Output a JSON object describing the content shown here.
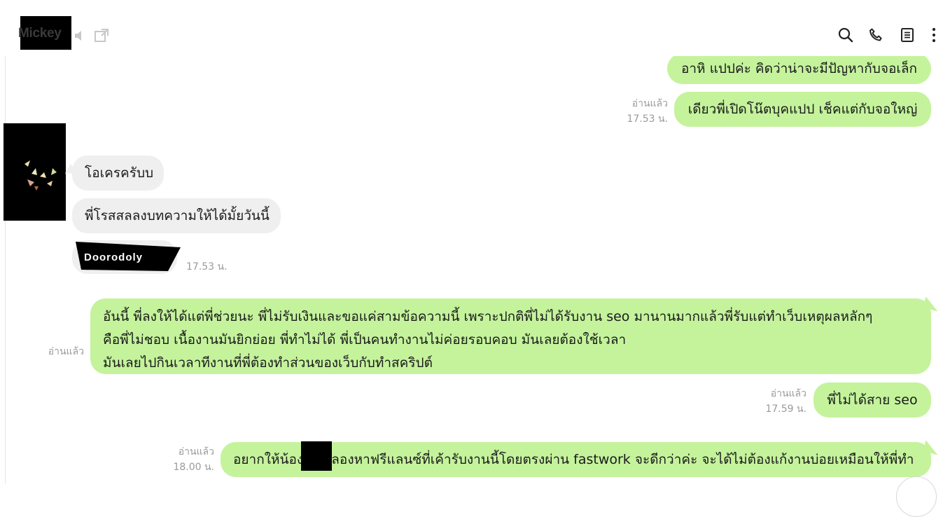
{
  "header": {
    "contact_name": "Mickey",
    "icons": [
      "mute-icon",
      "external-window-icon",
      "search-icon",
      "phone-icon",
      "notes-icon",
      "more-vertical-icon"
    ]
  },
  "messages": {
    "m1": {
      "text": "อาหิ แปปค่ะ คิดว่าน่าจะมีปัญหากับจอเล็ก"
    },
    "m2": {
      "text": "เดียวพี่เปิดโน๊ตบุคแปป เช็คแต่กับจอใหญ่",
      "read": "อ่านแล้ว",
      "time": "17.53 น."
    },
    "m3": {
      "text": "โอเครครับบ"
    },
    "m4": {
      "text": "พี่โรสสลลงบทความให้ได้มั้ยวันนี้"
    },
    "m5": {
      "sticker_text": "Doorodoly",
      "time": "17.53 น."
    },
    "m6": {
      "lines": [
        "อันนี้ พี่ลงให้ได้แต่พี่ช่วยนะ พี่ไม่รับเงินและขอแค่สามข้อความนี้ เพราะปกติพี่ไม่ได้รับงาน seo มานานมากแล้วพี่รับแต่ทำเว็บเหตุผลหลักๆ",
        "คือพี่ไม่ชอบ เนื้องานมันยิกย่อย พี่ทำไม่ได้ พี่เป็นคนทำงานไม่ค่อยรอบคอบ มันเลยต้องใช้เวลา",
        "มันเลยไปกินเวลาทีงานที่พี่ต้องทำส่วนของเว็บกับทำสคริปต์"
      ],
      "read": "อ่านแล้ว"
    },
    "m7": {
      "text": "พี่ไม่ได้สาย seo",
      "read": "อ่านแล้ว",
      "time": "17.59 น."
    },
    "m8": {
      "text": "อยากให้น้องก้อย ลองหาฟรีแลนซ์ที่เค้ารับงานนี้โดยตรงผ่าน fastwork จะดีกว่าค่ะ จะได้ไม่ต้องแก้งานบ่อยเหมือนให้พี่ทำ",
      "read": "อ่านแล้ว",
      "time": "18.00 น."
    }
  },
  "colors": {
    "outgoing": "#c4f39c",
    "incoming": "#efefef",
    "meta": "#9a9a9a"
  }
}
